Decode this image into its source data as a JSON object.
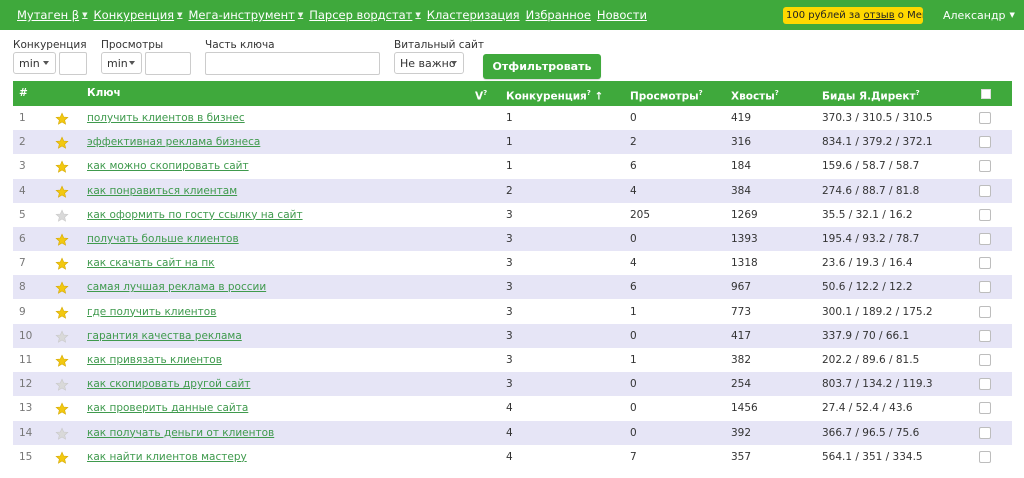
{
  "nav": [
    {
      "label": "Мутаген β",
      "dropdown": true
    },
    {
      "label": "Конкуренция",
      "dropdown": true
    },
    {
      "label": "Мега-инструмент",
      "dropdown": true
    },
    {
      "label": "Парсер вордстат",
      "dropdown": true
    },
    {
      "label": "Кластеризация",
      "dropdown": false
    },
    {
      "label": "Избранное",
      "dropdown": false
    },
    {
      "label": "Новости",
      "dropdown": false
    }
  ],
  "promo": {
    "text_before": "100 рублей за ",
    "link": "отзыв",
    "text_after": " о Мега-..."
  },
  "user": {
    "name": "Александр"
  },
  "filters": {
    "competition": {
      "label": "Конкуренция",
      "value": "min"
    },
    "views": {
      "label": "Просмотры",
      "value": "min"
    },
    "key_part": {
      "label": "Часть ключа",
      "value": ""
    },
    "vital_site": {
      "label": "Витальный сайт",
      "value": "Не важно"
    },
    "submit": "Отфильтровать"
  },
  "table": {
    "headers": {
      "num": "#",
      "key": "Ключ",
      "v": "V",
      "competition": "Конкуренция",
      "sort_arrow": "↑",
      "views": "Просмотры",
      "tails": "Хвосты",
      "bids": "Биды Я.Директ",
      "help": "?"
    },
    "rows": [
      {
        "num": "1",
        "starred": true,
        "key": "получить клиентов в бизнес",
        "competition": "1",
        "views": "0",
        "tails": "419",
        "bids": "370.3 / 310.5 / 310.5"
      },
      {
        "num": "2",
        "starred": true,
        "key": "эффективная реклама бизнеса",
        "competition": "1",
        "views": "2",
        "tails": "316",
        "bids": "834.1 / 379.2 / 372.1"
      },
      {
        "num": "3",
        "starred": true,
        "key": "как можно скопировать сайт",
        "competition": "1",
        "views": "6",
        "tails": "184",
        "bids": "159.6 / 58.7 / 58.7"
      },
      {
        "num": "4",
        "starred": true,
        "key": "как понравиться клиентам",
        "competition": "2",
        "views": "4",
        "tails": "384",
        "bids": "274.6 / 88.7 / 81.8"
      },
      {
        "num": "5",
        "starred": false,
        "key": "как оформить по госту ссылку на сайт",
        "competition": "3",
        "views": "205",
        "tails": "1269",
        "bids": "35.5 / 32.1 / 16.2"
      },
      {
        "num": "6",
        "starred": true,
        "key": "получать больше клиентов",
        "competition": "3",
        "views": "0",
        "tails": "1393",
        "bids": "195.4 / 93.2 / 78.7"
      },
      {
        "num": "7",
        "starred": true,
        "key": "как скачать сайт на пк",
        "competition": "3",
        "views": "4",
        "tails": "1318",
        "bids": "23.6 / 19.3 / 16.4"
      },
      {
        "num": "8",
        "starred": true,
        "key": "самая лучшая реклама в россии",
        "competition": "3",
        "views": "6",
        "tails": "967",
        "bids": "50.6 / 12.2 / 12.2"
      },
      {
        "num": "9",
        "starred": true,
        "key": "где получить клиентов",
        "competition": "3",
        "views": "1",
        "tails": "773",
        "bids": "300.1 / 189.2 / 175.2"
      },
      {
        "num": "10",
        "starred": false,
        "key": "гарантия качества реклама",
        "competition": "3",
        "views": "0",
        "tails": "417",
        "bids": "337.9 / 70 / 66.1"
      },
      {
        "num": "11",
        "starred": true,
        "key": "как привязать клиентов",
        "competition": "3",
        "views": "1",
        "tails": "382",
        "bids": "202.2 / 89.6 / 81.5"
      },
      {
        "num": "12",
        "starred": false,
        "key": "как скопировать другой сайт",
        "competition": "3",
        "views": "0",
        "tails": "254",
        "bids": "803.7 / 134.2 / 119.3"
      },
      {
        "num": "13",
        "starred": true,
        "key": "как проверить данные сайта",
        "competition": "4",
        "views": "0",
        "tails": "1456",
        "bids": "27.4 / 52.4 / 43.6"
      },
      {
        "num": "14",
        "starred": false,
        "key": "как получать деньги от клиентов",
        "competition": "4",
        "views": "0",
        "tails": "392",
        "bids": "366.7 / 96.5 / 75.6"
      },
      {
        "num": "15",
        "starred": true,
        "key": "как найти клиентов мастеру",
        "competition": "4",
        "views": "7",
        "tails": "357",
        "bids": "564.1 / 351 / 334.5"
      }
    ]
  },
  "colors": {
    "brand": "#3fa93c",
    "row_alt": "#e6e5f6",
    "link": "#3f9a4d",
    "promo": "#ffd800",
    "star_on": "#f2c811",
    "star_off": "#d9d9d9"
  }
}
